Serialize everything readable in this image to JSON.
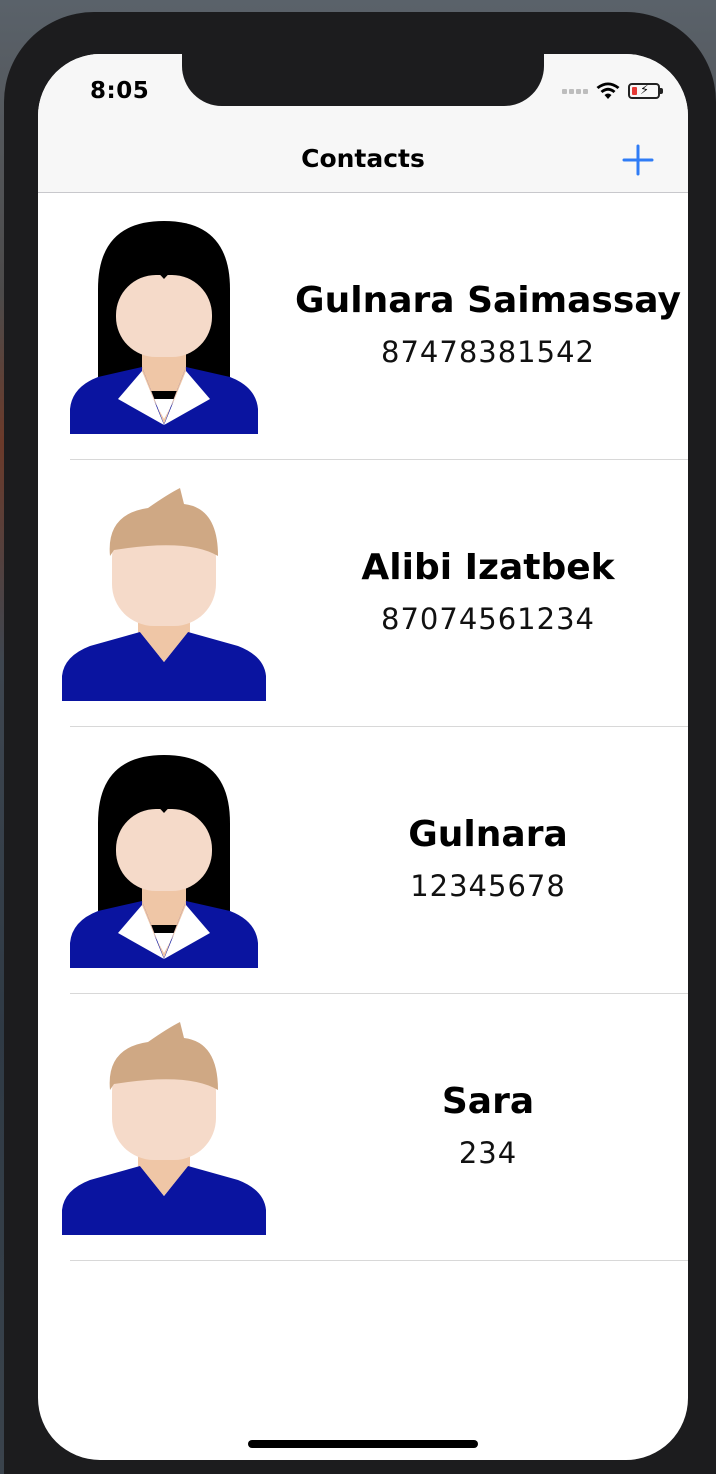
{
  "status_bar": {
    "time": "8:05",
    "icons": [
      "signal-icon",
      "wifi-icon",
      "battery-charging-icon"
    ]
  },
  "nav": {
    "title": "Contacts",
    "add_icon": "plus-icon",
    "accent_color": "#2f7cf6"
  },
  "contacts": [
    {
      "name": "Gulnara Saimassay",
      "phone": "87478381542",
      "avatar": "female-avatar-icon"
    },
    {
      "name": "Alibi Izatbek",
      "phone": "87074561234",
      "avatar": "male-avatar-icon"
    },
    {
      "name": "Gulnara",
      "phone": "12345678",
      "avatar": "female-avatar-icon"
    },
    {
      "name": "Sara",
      "phone": "234",
      "avatar": "male-avatar-icon"
    }
  ],
  "colors": {
    "suit": "#0a14a0",
    "skin": "#f5dac9",
    "neck": "#efc6a6",
    "female_hair": "#000000",
    "male_hair": "#cfa884"
  }
}
